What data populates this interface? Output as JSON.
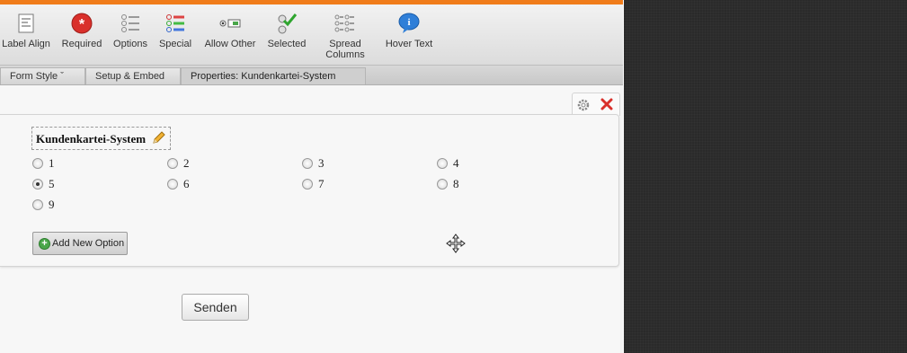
{
  "toolbar": {
    "items": [
      {
        "label": "Label Align",
        "icon": "label-align-icon"
      },
      {
        "label": "Required",
        "icon": "required-icon"
      },
      {
        "label": "Options",
        "icon": "options-icon"
      },
      {
        "label": "Special",
        "icon": "special-icon"
      },
      {
        "label": "Allow Other",
        "icon": "allow-other-icon"
      },
      {
        "label": "Selected",
        "icon": "selected-icon"
      },
      {
        "label": "Spread Columns",
        "icon": "spread-columns-icon"
      },
      {
        "label": "Hover Text",
        "icon": "hover-text-icon"
      }
    ]
  },
  "tabs": [
    {
      "label": "Form Style ˇ"
    },
    {
      "label": "Setup & Embed"
    },
    {
      "label": "Properties: Kundenkartei-System"
    }
  ],
  "field": {
    "question": "Kundenkartei-System",
    "options": [
      {
        "label": "1",
        "checked": false
      },
      {
        "label": "2",
        "checked": false
      },
      {
        "label": "3",
        "checked": false
      },
      {
        "label": "4",
        "checked": false
      },
      {
        "label": "5",
        "checked": true
      },
      {
        "label": "6",
        "checked": false
      },
      {
        "label": "7",
        "checked": false
      },
      {
        "label": "8",
        "checked": false
      },
      {
        "label": "9",
        "checked": false
      }
    ],
    "add_option_label": "Add New Option"
  },
  "submit_label": "Senden",
  "colors": {
    "accent": "#f07c1a",
    "delete": "#d9302b",
    "add": "#4aa64a"
  }
}
